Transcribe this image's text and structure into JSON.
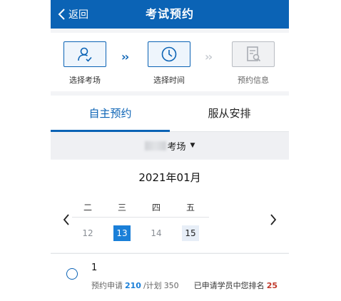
{
  "header": {
    "back_label": "返回",
    "title": "考试预约"
  },
  "steps": [
    {
      "label": "选择考场",
      "icon": "user-check-icon",
      "state": "done"
    },
    {
      "label": "选择时间",
      "icon": "clock-icon",
      "state": "active"
    },
    {
      "label": "预约信息",
      "icon": "document-search-icon",
      "state": "inactive"
    }
  ],
  "tabs": [
    {
      "label": "自主预约",
      "active": true
    },
    {
      "label": "服从安排",
      "active": false
    }
  ],
  "venue": {
    "label": "考场"
  },
  "calendar": {
    "month": "2021年01月",
    "weekdays": [
      "二",
      "三",
      "四",
      "五"
    ],
    "days": [
      {
        "label": "12",
        "state": "disabled"
      },
      {
        "label": "13",
        "state": "selected"
      },
      {
        "label": "14",
        "state": "disabled"
      },
      {
        "label": "15",
        "state": "available"
      }
    ]
  },
  "slot": {
    "name": "1",
    "applied_label": "预约申请",
    "applied_count": "210",
    "plan_label": "/计划",
    "plan_count": "350",
    "rank_label": "已申请学员中您排名",
    "rank_value": "25"
  },
  "colors": {
    "primary": "#0b63b5",
    "selected_day": "#1a7fd8",
    "rank_red": "#c0392b",
    "inactive": "#b8bcc2"
  }
}
